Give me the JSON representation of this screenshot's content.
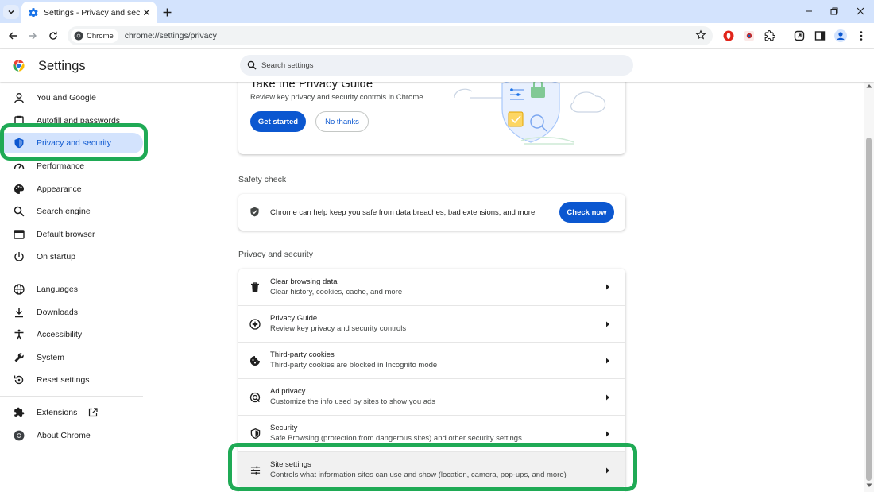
{
  "browser": {
    "tab_title": "Settings - Privacy and security",
    "omnibox_chip": "Chrome",
    "url": "chrome://settings/privacy"
  },
  "settings": {
    "title": "Settings",
    "search_placeholder": "Search settings"
  },
  "sidebar": {
    "items": [
      {
        "label": "You and Google",
        "icon": "person-icon"
      },
      {
        "label": "Autofill and passwords",
        "icon": "clipboard-icon"
      },
      {
        "label": "Privacy and security",
        "icon": "shield-icon",
        "active": true
      },
      {
        "label": "Performance",
        "icon": "speedometer-icon"
      },
      {
        "label": "Appearance",
        "icon": "palette-icon"
      },
      {
        "label": "Search engine",
        "icon": "search-icon"
      },
      {
        "label": "Default browser",
        "icon": "browser-window-icon"
      },
      {
        "label": "On startup",
        "icon": "power-icon"
      },
      {
        "label": "Languages",
        "icon": "globe-icon"
      },
      {
        "label": "Downloads",
        "icon": "download-icon"
      },
      {
        "label": "Accessibility",
        "icon": "accessibility-icon"
      },
      {
        "label": "System",
        "icon": "wrench-icon"
      },
      {
        "label": "Reset settings",
        "icon": "reset-icon"
      },
      {
        "label": "Extensions",
        "icon": "puzzle-icon"
      },
      {
        "label": "About Chrome",
        "icon": "chrome-logo-icon"
      }
    ]
  },
  "privacy_guide_card": {
    "title": "Take the Privacy Guide",
    "description": "Review key privacy and security controls in Chrome",
    "get_started": "Get started",
    "no_thanks": "No thanks"
  },
  "safety_check": {
    "section_label": "Safety check",
    "text": "Chrome can help keep you safe from data breaches, bad extensions, and more",
    "button": "Check now"
  },
  "privacy_section": {
    "label": "Privacy and security",
    "rows": [
      {
        "title": "Clear browsing data",
        "subtitle": "Clear history, cookies, cache, and more",
        "icon": "trash-icon"
      },
      {
        "title": "Privacy Guide",
        "subtitle": "Review key privacy and security controls",
        "icon": "compass-icon"
      },
      {
        "title": "Third-party cookies",
        "subtitle": "Third-party cookies are blocked in Incognito mode",
        "icon": "cookie-icon"
      },
      {
        "title": "Ad privacy",
        "subtitle": "Customize the info used by sites to show you ads",
        "icon": "ad-privacy-icon"
      },
      {
        "title": "Security",
        "subtitle": "Safe Browsing (protection from dangerous sites) and other security settings",
        "icon": "shield-icon"
      },
      {
        "title": "Site settings",
        "subtitle": "Controls what information sites can use and show (location, camera, pop-ups, and more)",
        "icon": "sliders-icon"
      }
    ]
  },
  "colors": {
    "accent": "#0b57d0",
    "active_nav_bg": "#d3e3fd",
    "highlight": "#1faa55"
  }
}
